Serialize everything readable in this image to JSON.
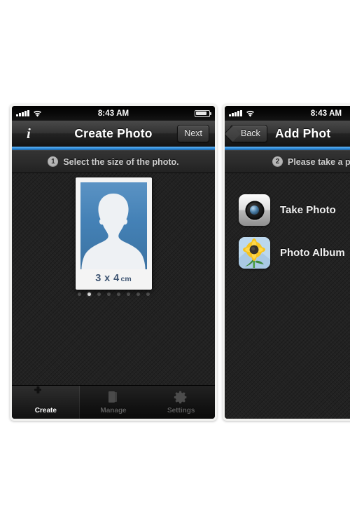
{
  "app": {
    "accent_color": "#3d9ae6",
    "screen_bg": "#222222",
    "card_blue": "#4481b6"
  },
  "screens": [
    {
      "id": "create-photo",
      "status_bar": {
        "signal_icon": "signal-bars-icon",
        "wifi_icon": "wifi-icon",
        "time": "8:43 AM",
        "battery_icon": "battery-icon"
      },
      "nav": {
        "left_button": {
          "icon": "info-icon",
          "label": "i"
        },
        "title": "Create Photo",
        "right_button": {
          "label": "Next"
        }
      },
      "step": {
        "number": "1",
        "text": "Select the size of the photo."
      },
      "photo_card": {
        "silhouette_icon": "person-silhouette-icon",
        "size_value": "3 x 4",
        "size_unit": "cm"
      },
      "pager": {
        "total": 8,
        "active_index": 1
      },
      "tabs": [
        {
          "label": "Create",
          "icon": "plus-circle-icon",
          "active": true
        },
        {
          "label": "Manage",
          "icon": "stacked-cards-icon",
          "active": false
        },
        {
          "label": "Settings",
          "icon": "gear-icon",
          "active": false
        }
      ]
    },
    {
      "id": "add-photo",
      "status_bar": {
        "signal_icon": "signal-bars-icon",
        "wifi_icon": "wifi-icon",
        "time": "8:43 AM",
        "battery_icon": "battery-icon"
      },
      "nav": {
        "left_button": {
          "label": "Back"
        },
        "title": "Add Phot"
      },
      "step": {
        "number": "2",
        "text": "Please take a p"
      },
      "rows": [
        {
          "label": "Take Photo",
          "icon": "camera-app-icon"
        },
        {
          "label": "Photo Album",
          "icon": "photos-app-icon"
        }
      ]
    }
  ]
}
